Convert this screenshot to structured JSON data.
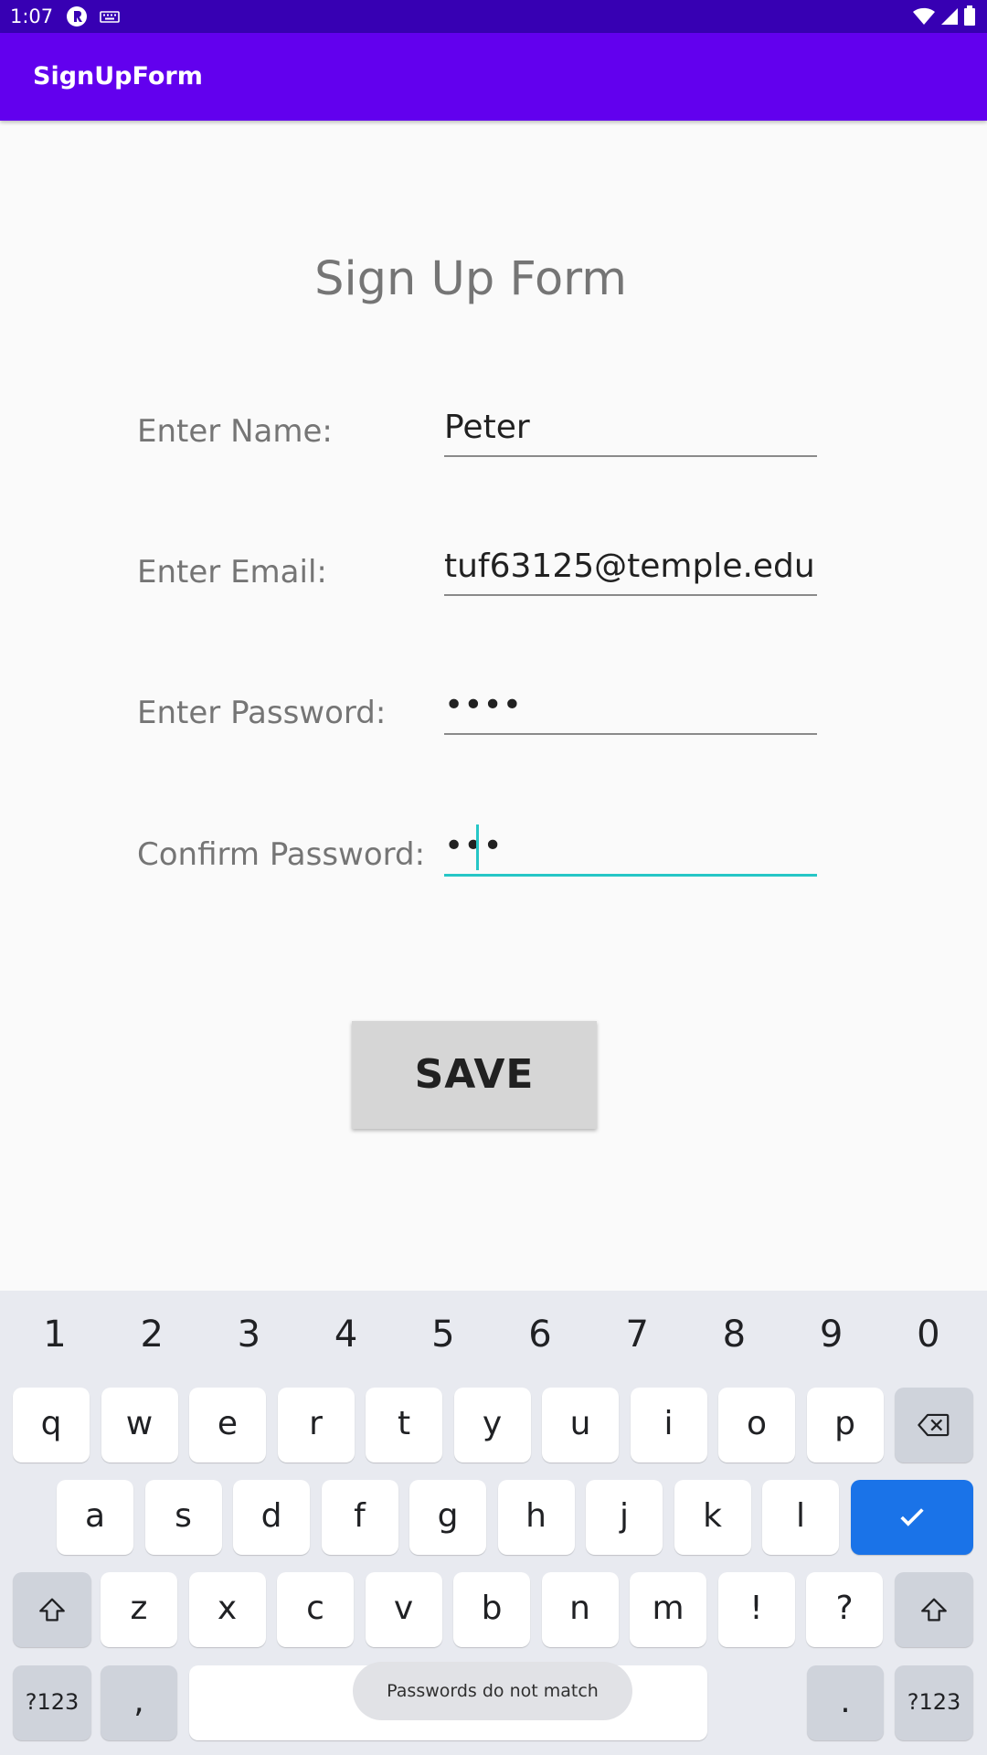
{
  "status_bar": {
    "time": "1:07",
    "left_icons": [
      "app-r-icon",
      "keyboard-icon"
    ],
    "right_icons": [
      "wifi-icon",
      "signal-icon",
      "battery-icon"
    ]
  },
  "app_bar": {
    "title": "SignUpForm"
  },
  "form": {
    "title": "Sign Up Form",
    "fields": [
      {
        "label": "Enter Name:",
        "value": "Peter"
      },
      {
        "label": "Enter Email:",
        "value": "tuf63125@temple.edu"
      },
      {
        "label": "Enter Password:",
        "value": "••••"
      },
      {
        "label": "Confirm Password:",
        "value": "•••"
      }
    ],
    "save_label": "SAVE",
    "focused_field": "Confirm Password:",
    "accent_color": "#26c6c6"
  },
  "keyboard": {
    "numbers": [
      "1",
      "2",
      "3",
      "4",
      "5",
      "6",
      "7",
      "8",
      "9",
      "0"
    ],
    "row1": [
      "q",
      "w",
      "e",
      "r",
      "t",
      "y",
      "u",
      "i",
      "o",
      "p"
    ],
    "row2": [
      "a",
      "s",
      "d",
      "f",
      "g",
      "h",
      "j",
      "k",
      "l"
    ],
    "row3": [
      "z",
      "x",
      "c",
      "v",
      "b",
      "n",
      "m",
      "!",
      "?"
    ],
    "symbols_key": "?123",
    "comma_key": ",",
    "period_key": ".",
    "enter_icon": "check-icon",
    "backspace_icon": "backspace-icon",
    "shift_icon": "shift-icon",
    "enter_color": "#1a73e8"
  },
  "toast": {
    "message": "Passwords do not match"
  }
}
